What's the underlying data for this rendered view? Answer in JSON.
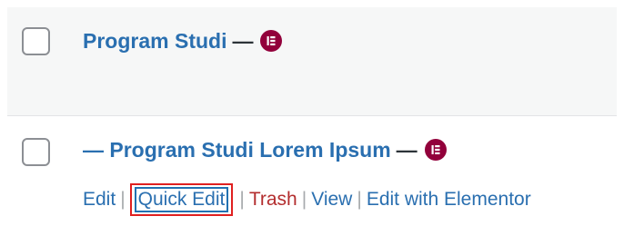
{
  "rows": [
    {
      "title": "Program Studi",
      "state_separator": "—",
      "editor_badge": "elementor-icon"
    },
    {
      "title": "— Program Studi Lorem Ipsum",
      "state_separator": "—",
      "editor_badge": "elementor-icon",
      "actions": {
        "edit": "Edit",
        "separator_1": "|",
        "quick_edit": "Quick Edit",
        "separator_2": "|",
        "trash": "Trash",
        "separator_3": "|",
        "view": "View",
        "separator_4": "|",
        "edit_with_elementor": "Edit with Elementor"
      }
    }
  ],
  "colors": {
    "link": "#2a6fb0",
    "trash": "#b32d2e",
    "elementor_badge": "#92003b",
    "highlight_box": "#e02020",
    "focus_ring": "#2271b1",
    "alt_row": "#f6f7f7"
  }
}
